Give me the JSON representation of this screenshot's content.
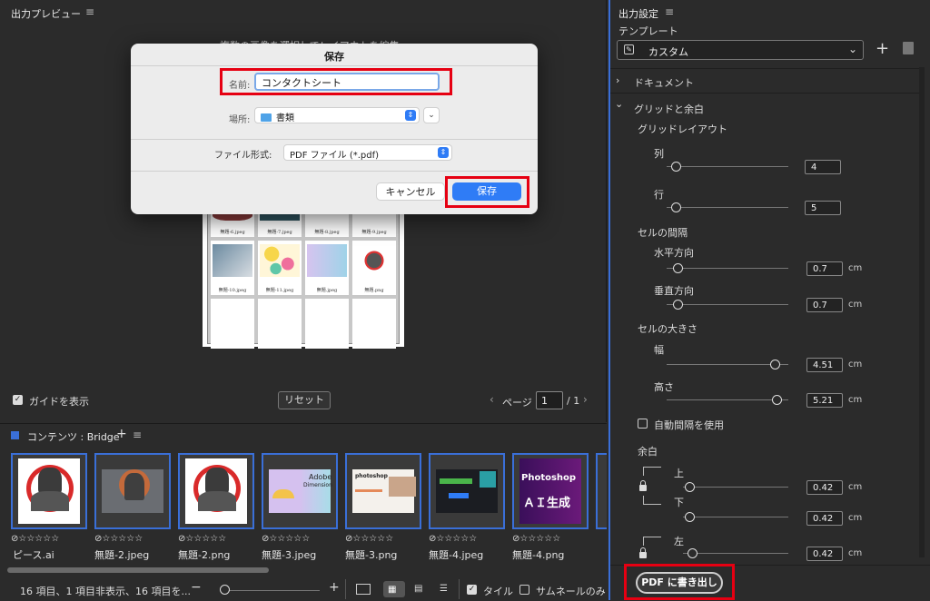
{
  "preview": {
    "title": "出力プレビュー",
    "hint": "複数の画像を選択してレイアウトを編集",
    "cells_row1": [
      "無題-6.jpeg",
      "無題-7.jpeg",
      "無題-8.jpeg",
      "無題-9.jpeg"
    ],
    "cells_row2": [
      "無題-10.jpeg",
      "無題-11.jpeg",
      "無題.jpeg",
      "無題.png"
    ],
    "show_guides_label": "ガイドを表示",
    "reset_label": "リセット",
    "page_label": "ページ",
    "page_current": "1",
    "page_total": "/ 1"
  },
  "dialog": {
    "title": "保存",
    "name_label": "名前:",
    "name_value": "コンタクトシート",
    "location_label": "場所:",
    "location_value": "書類",
    "format_label": "ファイル形式:",
    "format_value": "PDF ファイル (*.pdf)",
    "cancel_label": "キャンセル",
    "save_label": "保存"
  },
  "content": {
    "title": "コンテンツ : Bridge",
    "items": [
      {
        "name": "ピース.ai",
        "rating": "⊘☆☆☆☆☆"
      },
      {
        "name": "無題-2.jpeg",
        "rating": "⊘☆☆☆☆☆"
      },
      {
        "name": "無題-2.png",
        "rating": "⊘☆☆☆☆☆"
      },
      {
        "name": "無題-3.jpeg",
        "rating": "⊘☆☆☆☆☆"
      },
      {
        "name": "無題-3.png",
        "rating": "⊘☆☆☆☆☆"
      },
      {
        "name": "無題-4.jpeg",
        "rating": "⊘☆☆☆☆☆"
      },
      {
        "name": "無題-4.png",
        "rating": "⊘☆☆☆☆☆"
      }
    ],
    "thumb_texts": {
      "adobe": "Adobe",
      "dimension": "Dimension",
      "photoshop_small": "photoshop",
      "photoshop_big": "Photoshop",
      "ai_gen": "ＡＩ生成"
    },
    "status": "16 項目、1 項目非表示、16 項目を...",
    "tile_label": "タイル",
    "thumb_only_label": "サムネールのみ"
  },
  "settings": {
    "title": "出力設定",
    "template_label": "テンプレート",
    "template_value": "カスタム",
    "document_label": "ドキュメント",
    "grid_margin_label": "グリッドと余白",
    "grid_layout_label": "グリッドレイアウト",
    "columns_label": "列",
    "columns_value": "4",
    "rows_label": "行",
    "rows_value": "5",
    "cell_spacing_label": "セルの間隔",
    "horizontal_label": "水平方向",
    "horizontal_value": "0.7",
    "vertical_label": "垂直方向",
    "vertical_value": "0.7",
    "cell_size_label": "セルの大きさ",
    "width_label": "幅",
    "width_value": "4.51",
    "height_label": "高さ",
    "height_value": "5.21",
    "auto_spacing_label": "自動間隔を使用",
    "margin_label": "余白",
    "top_label": "上",
    "top_value": "0.42",
    "bottom_label": "下",
    "bottom_value": "0.42",
    "left_label": "左",
    "left_value": "0.42",
    "unit": "cm",
    "export_label": "PDF に書き出し"
  },
  "colors": {
    "accent": "#2f7cf6",
    "highlight": "#e60012",
    "panel_bg": "#2b2b2b"
  }
}
